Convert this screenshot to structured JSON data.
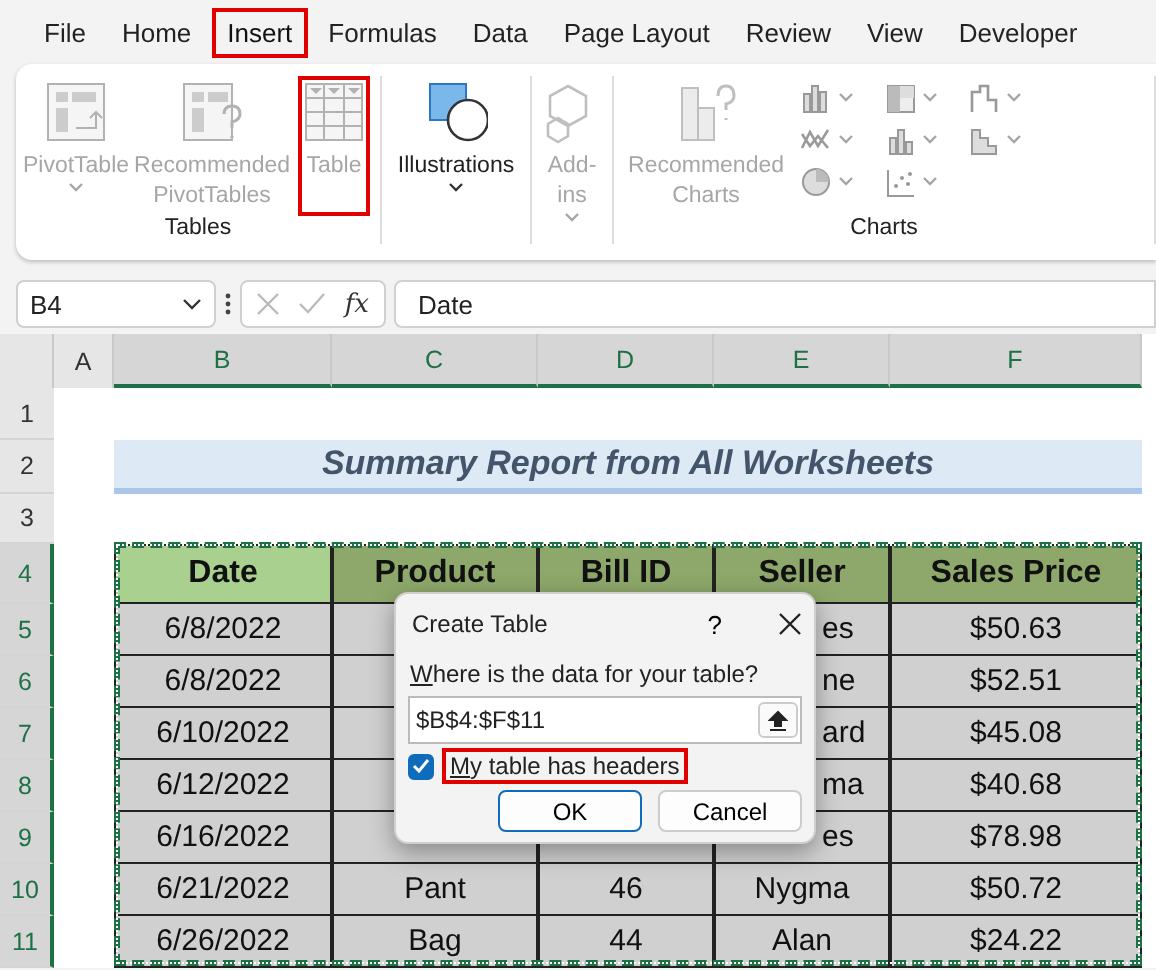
{
  "menu_tabs": [
    {
      "label": "File",
      "selected": false,
      "highlighted": false
    },
    {
      "label": "Home",
      "selected": false,
      "highlighted": false
    },
    {
      "label": "Insert",
      "selected": true,
      "highlighted": true
    },
    {
      "label": "Formulas",
      "selected": false,
      "highlighted": false
    },
    {
      "label": "Data",
      "selected": false,
      "highlighted": false
    },
    {
      "label": "Page Layout",
      "selected": false,
      "highlighted": false
    },
    {
      "label": "Review",
      "selected": false,
      "highlighted": false
    },
    {
      "label": "View",
      "selected": false,
      "highlighted": false
    },
    {
      "label": "Developer",
      "selected": false,
      "highlighted": false
    }
  ],
  "ribbon": {
    "groups": [
      {
        "label": "Tables",
        "items": [
          {
            "kind": "pivot",
            "label": "PivotTable",
            "disabled": true,
            "dropdown": true,
            "highlighted": false
          },
          {
            "kind": "recommended-pivot",
            "label": "Recommended PivotTables",
            "disabled": true,
            "dropdown": false,
            "highlighted": false
          },
          {
            "kind": "table",
            "label": "Table",
            "disabled": true,
            "dropdown": false,
            "highlighted": true
          }
        ]
      },
      {
        "items": [
          {
            "kind": "illustrations",
            "label": "Illustrations",
            "disabled": false,
            "dropdown": true,
            "highlighted": false
          }
        ]
      },
      {
        "items": [
          {
            "kind": "addins",
            "label": "Add-ins",
            "disabled": true,
            "dropdown": true,
            "highlighted": false
          }
        ]
      },
      {
        "label": "Charts",
        "items": [
          {
            "kind": "recommended-charts",
            "label": "Recommended Charts",
            "disabled": true,
            "dropdown": false,
            "highlighted": false
          }
        ],
        "chart_types": true
      }
    ]
  },
  "formula_bar": {
    "name_box": "B4",
    "function_label": "fx",
    "formula": "Date"
  },
  "sheet": {
    "columns": [
      {
        "label": "A",
        "selected": false
      },
      {
        "label": "B",
        "selected": true
      },
      {
        "label": "C",
        "selected": true
      },
      {
        "label": "D",
        "selected": true
      },
      {
        "label": "E",
        "selected": true
      },
      {
        "label": "F",
        "selected": true
      }
    ],
    "row_numbers": [
      {
        "label": "1",
        "selected": false
      },
      {
        "label": "2",
        "selected": false
      },
      {
        "label": "3",
        "selected": false
      },
      {
        "label": "4",
        "selected": true
      },
      {
        "label": "5",
        "selected": true
      },
      {
        "label": "6",
        "selected": true
      },
      {
        "label": "7",
        "selected": true
      },
      {
        "label": "8",
        "selected": true
      },
      {
        "label": "9",
        "selected": true
      },
      {
        "label": "10",
        "selected": true
      },
      {
        "label": "11",
        "selected": true
      }
    ],
    "title": "Summary Report from All Worksheets",
    "table": {
      "headers": [
        {
          "text": "Date",
          "active": true
        },
        {
          "text": "Product",
          "active": false
        },
        {
          "text": "Bill ID",
          "active": false
        },
        {
          "text": "Seller",
          "active": false
        },
        {
          "text": "Sales Price",
          "active": false
        }
      ],
      "rows": [
        [
          {
            "text": "6/8/2022",
            "cut": false
          },
          null,
          null,
          {
            "text": "es",
            "cut": true
          },
          {
            "text": "$50.63",
            "cut": false
          }
        ],
        [
          {
            "text": "6/8/2022",
            "cut": false
          },
          null,
          null,
          {
            "text": "ne",
            "cut": true
          },
          {
            "text": "$52.51",
            "cut": false
          }
        ],
        [
          {
            "text": "6/10/2022",
            "cut": false
          },
          null,
          null,
          {
            "text": "ard",
            "cut": true
          },
          {
            "text": "$45.08",
            "cut": false
          }
        ],
        [
          {
            "text": "6/12/2022",
            "cut": false
          },
          null,
          null,
          {
            "text": "ma",
            "cut": true
          },
          {
            "text": "$40.68",
            "cut": false
          }
        ],
        [
          {
            "text": "6/16/2022",
            "cut": false
          },
          null,
          null,
          {
            "text": "es",
            "cut": true
          },
          {
            "text": "$78.98",
            "cut": false
          }
        ],
        [
          {
            "text": "6/21/2022",
            "cut": false
          },
          {
            "text": "Pant",
            "cut": false
          },
          {
            "text": "46",
            "cut": false
          },
          {
            "text": "Nygma",
            "cut": false
          },
          {
            "text": "$50.72",
            "cut": false
          }
        ],
        [
          {
            "text": "6/26/2022",
            "cut": false
          },
          {
            "text": "Bag",
            "cut": false
          },
          {
            "text": "44",
            "cut": false
          },
          {
            "text": "Alan",
            "cut": false
          },
          {
            "text": "$24.22",
            "cut": false
          }
        ]
      ]
    }
  },
  "dialog": {
    "title": "Create Table",
    "help": "?",
    "prompt": "Where is the data for your table?",
    "range": "$B$4:$F$11",
    "checkbox": {
      "label": "My table has headers",
      "checked": true,
      "highlighted": true
    },
    "buttons": [
      {
        "label": "OK",
        "default": true
      },
      {
        "label": "Cancel",
        "default": false
      }
    ]
  }
}
